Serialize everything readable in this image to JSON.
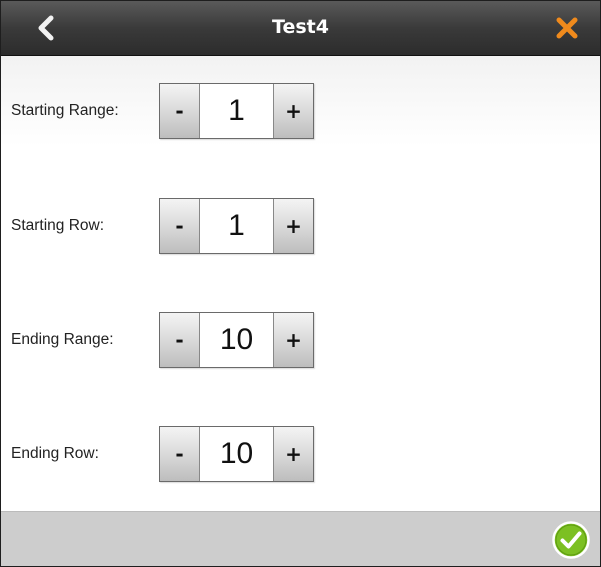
{
  "header": {
    "title": "Test4",
    "back_icon": "chevron-left-icon",
    "close_icon": "close-icon",
    "close_color": "#f08a1c"
  },
  "fields": [
    {
      "label": "Starting Range:",
      "value": "1",
      "minus_label": "-",
      "plus_label": "+"
    },
    {
      "label": "Starting Row:",
      "value": "1",
      "minus_label": "-",
      "plus_label": "+"
    },
    {
      "label": "Ending Range:",
      "value": "10",
      "minus_label": "-",
      "plus_label": "+"
    },
    {
      "label": "Ending Row:",
      "value": "10",
      "minus_label": "-",
      "plus_label": "+"
    }
  ],
  "footer": {
    "confirm_icon": "checkmark-circle-icon",
    "confirm_color": "#7cc022"
  }
}
